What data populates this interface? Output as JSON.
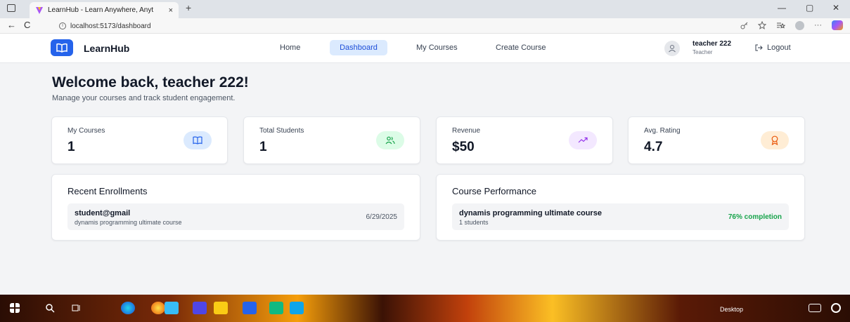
{
  "browser": {
    "tab_title": "LearnHub - Learn Anywhere, Anyt",
    "tab_close": "×",
    "new_tab": "+",
    "url": "localhost:5173/dashboard",
    "back": "←",
    "reload": "C",
    "win_min": "—",
    "win_max": "▢",
    "win_close": "✕",
    "addr_icons": [
      "key-icon",
      "star-icon",
      "favorites-icon",
      "profile-icon",
      "more-icon",
      "copilot-icon"
    ],
    "more": "···"
  },
  "header": {
    "brand": "LearnHub",
    "nav": {
      "home": "Home",
      "dashboard": "Dashboard",
      "my_courses": "My Courses",
      "create_course": "Create Course"
    },
    "user_name": "teacher 222",
    "user_role": "Teacher",
    "logout": "Logout"
  },
  "main": {
    "welcome": "Welcome back, teacher 222!",
    "subtitle": "Manage your courses and track student engagement.",
    "stats": [
      {
        "label": "My Courses",
        "value": "1",
        "icon": "book-icon",
        "color": "#2563eb",
        "bg": "#dbeafe"
      },
      {
        "label": "Total Students",
        "value": "1",
        "icon": "users-icon",
        "color": "#16a34a",
        "bg": "#dcfce7"
      },
      {
        "label": "Revenue",
        "value": "$50",
        "icon": "trending-up-icon",
        "color": "#9333ea",
        "bg": "#f3e8ff"
      },
      {
        "label": "Avg. Rating",
        "value": "4.7",
        "icon": "award-icon",
        "color": "#ea580c",
        "bg": "#ffedd5"
      }
    ],
    "recent_enrollments": {
      "title": "Recent Enrollments",
      "items": [
        {
          "student": "student@gmail",
          "course": "dynamis programming ultimate course",
          "date": "6/29/2025"
        }
      ]
    },
    "course_performance": {
      "title": "Course Performance",
      "items": [
        {
          "course": "dynamis programming ultimate course",
          "students": "1 students",
          "completion": "76% completion"
        }
      ]
    }
  },
  "taskbar": {
    "desktop_label": "Desktop"
  }
}
